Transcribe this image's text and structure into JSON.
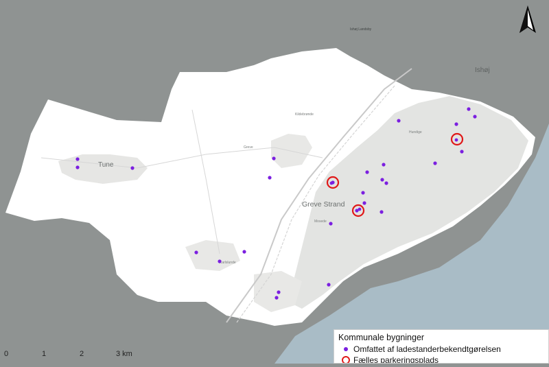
{
  "colors": {
    "basemap": "#8f9392",
    "municipality_fill": "#ffffff",
    "urban_area": "#e2e3e1",
    "sea": "#a9bcc6",
    "building_dot": "#7b1fe0",
    "parking_ring": "#e01818"
  },
  "place_labels": {
    "tune": "Tune",
    "greve": "Greve",
    "greve_strand": "Greve Strand",
    "hundige": "Hundige",
    "ishoj": "Ishøj",
    "ishoj_landsby": "Ishøj Landsby",
    "karlslunde": "Karlslunde",
    "mosede": "Mosede",
    "kildebronde": "Kildebrønde"
  },
  "legend": {
    "title": "Kommunale bygninger",
    "items": [
      {
        "label": "Omfattet af ladestanderbekendtgørelsen",
        "symbol": "purple-dot"
      },
      {
        "label": "Fælles parkeringsplads",
        "symbol": "red-ring"
      }
    ]
  },
  "scalebar": {
    "ticks": [
      "0",
      "1",
      "2",
      "3 km"
    ]
  },
  "north_arrow": {
    "label": "N",
    "icon": "north-arrow-icon"
  },
  "building_count": 27,
  "parking_count": 3
}
